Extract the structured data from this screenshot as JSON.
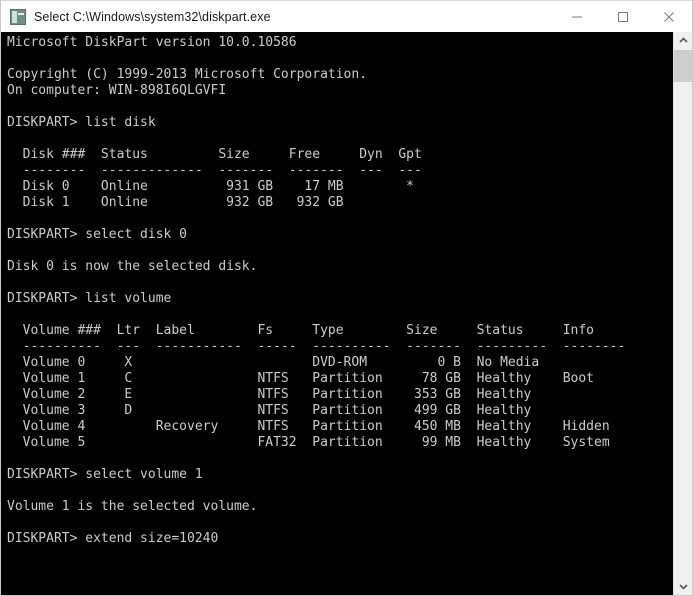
{
  "window": {
    "title": "Select C:\\Windows\\system32\\diskpart.exe",
    "icon": "console-icon",
    "controls": {
      "minimize": "minimize-button",
      "maximize": "maximize-button",
      "close": "close-button"
    },
    "background_color": "#000000",
    "text_color": "#cccccc",
    "titlebar_color": "#ffffff"
  },
  "scrollbar": {
    "up_arrow": "chevron-up-icon",
    "down_arrow": "chevron-down-icon",
    "thumb": "scrollbar-thumb"
  },
  "console": {
    "banner": [
      "Microsoft DiskPart version 10.0.10586",
      "",
      "Copyright (C) 1999-2013 Microsoft Corporation.",
      "On computer: WIN-898I6QLGVFI"
    ],
    "version": "10.0.10586",
    "copyright": "Copyright (C) 1999-2013 Microsoft Corporation.",
    "computer_name": "WIN-898I6QLGVFI",
    "prompt": "DISKPART>",
    "commands": [
      "list disk",
      "select disk 0",
      "list volume",
      "select volume 1",
      "extend size=10240"
    ],
    "messages": [
      "Disk 0 is now the selected disk.",
      "Volume 1 is the selected volume."
    ],
    "disk_table": {
      "headers": [
        "Disk ###",
        "Status",
        "Size",
        "Free",
        "Dyn",
        "Gpt"
      ],
      "separators": [
        "--------",
        "-------------",
        "-------",
        "-------",
        "---",
        "---"
      ],
      "rows": [
        [
          "Disk 0",
          "Online",
          "931 GB",
          "17 MB",
          "",
          "*"
        ],
        [
          "Disk 1",
          "Online",
          "932 GB",
          "932 GB",
          "",
          ""
        ]
      ]
    },
    "volume_table": {
      "headers": [
        "Volume ###",
        "Ltr",
        "Label",
        "Fs",
        "Type",
        "Size",
        "Status",
        "Info"
      ],
      "separators": [
        "----------",
        "---",
        "-----------",
        "-----",
        "----------",
        "-------",
        "---------",
        "--------"
      ],
      "rows": [
        [
          "Volume 0",
          "X",
          "",
          "",
          "DVD-ROM",
          "0 B",
          "No Media",
          ""
        ],
        [
          "Volume 1",
          "C",
          "",
          "NTFS",
          "Partition",
          "78 GB",
          "Healthy",
          "Boot"
        ],
        [
          "Volume 2",
          "E",
          "",
          "NTFS",
          "Partition",
          "353 GB",
          "Healthy",
          ""
        ],
        [
          "Volume 3",
          "D",
          "",
          "NTFS",
          "Partition",
          "499 GB",
          "Healthy",
          ""
        ],
        [
          "Volume 4",
          "",
          "Recovery",
          "NTFS",
          "Partition",
          "450 MB",
          "Healthy",
          "Hidden"
        ],
        [
          "Volume 5",
          "",
          "",
          "FAT32",
          "Partition",
          "99 MB",
          "Healthy",
          "System"
        ]
      ]
    },
    "screen_text": "Microsoft DiskPart version 10.0.10586\n\nCopyright (C) 1999-2013 Microsoft Corporation.\nOn computer: WIN-898I6QLGVFI\n\nDISKPART> list disk\n\n  Disk ###  Status         Size     Free     Dyn  Gpt\n  --------  -------------  -------  -------  ---  ---\n  Disk 0    Online          931 GB    17 MB        *\n  Disk 1    Online          932 GB   932 GB\n\nDISKPART> select disk 0\n\nDisk 0 is now the selected disk.\n\nDISKPART> list volume\n\n  Volume ###  Ltr  Label        Fs     Type        Size     Status     Info\n  ----------  ---  -----------  -----  ----------  -------  ---------  --------\n  Volume 0     X                       DVD-ROM         0 B  No Media\n  Volume 1     C                NTFS   Partition     78 GB  Healthy    Boot\n  Volume 2     E                NTFS   Partition    353 GB  Healthy\n  Volume 3     D                NTFS   Partition    499 GB  Healthy\n  Volume 4         Recovery     NTFS   Partition    450 MB  Healthy    Hidden\n  Volume 5                      FAT32  Partition     99 MB  Healthy    System\n\nDISKPART> select volume 1\n\nVolume 1 is the selected volume.\n\nDISKPART> extend size=10240"
  }
}
